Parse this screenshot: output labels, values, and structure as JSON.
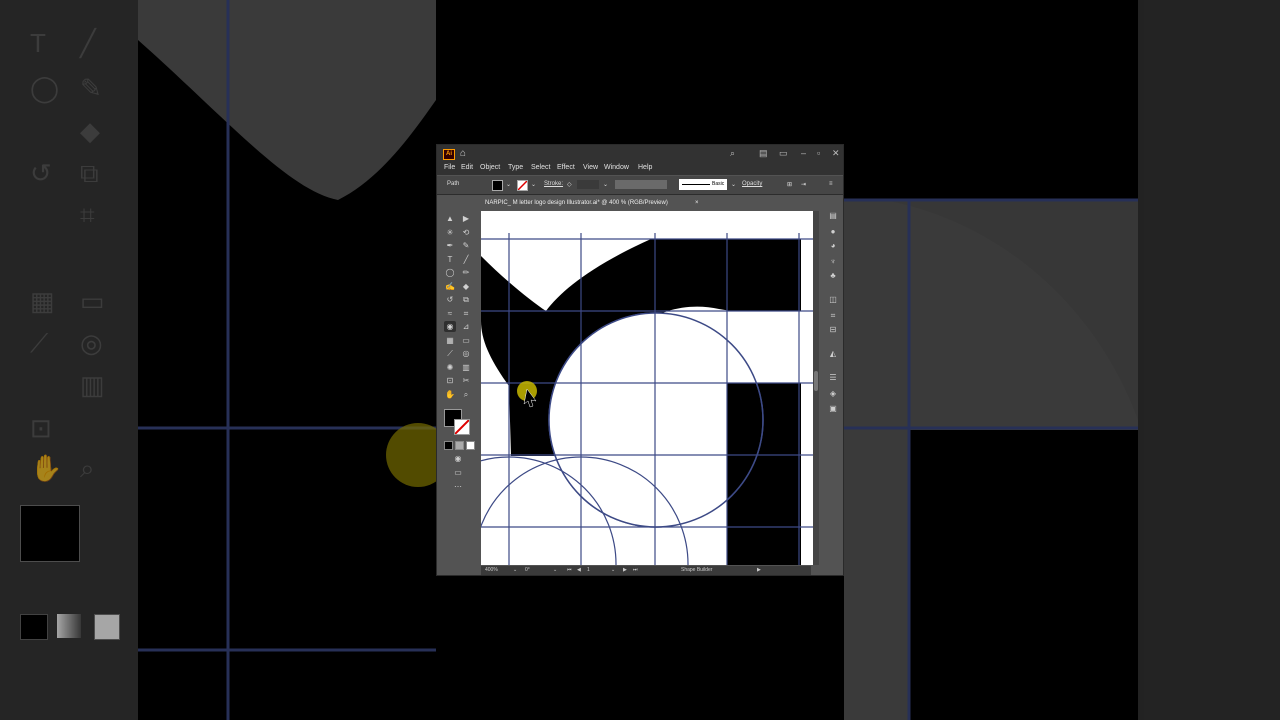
{
  "window": {
    "app_icon_label": "Ai",
    "home_icon": "home-icon",
    "search_icon": "search-icon",
    "minimize_icon": "minimize-icon",
    "restore_icon": "restore-icon",
    "close_icon": "close-icon"
  },
  "menu": [
    "File",
    "Edit",
    "Object",
    "Type",
    "Select",
    "Effect",
    "View",
    "Window",
    "Help"
  ],
  "control_bar": {
    "selection_label": "Path",
    "stroke_label": "Stroke:",
    "brush_label": "Basic",
    "opacity_label": "Opacity"
  },
  "document_tab": {
    "title": "NARPIC_ M letter logo design Illustrator.ai* @ 400 % (RGB/Preview)",
    "close_glyph": "×"
  },
  "status_bar": {
    "zoom": "400%",
    "rotation": "0°",
    "artboard": "1",
    "current_tool": "Shape Builder"
  },
  "tools": [
    "selection-tool",
    "direct-selection-tool",
    "magic-wand-tool",
    "lasso-tool",
    "pen-tool",
    "curvature-tool",
    "type-tool",
    "line-tool",
    "ellipse-tool",
    "paintbrush-tool",
    "shaper-tool",
    "eraser-tool",
    "rotate-tool",
    "scale-tool",
    "warp-tool",
    "free-transform-tool",
    "shape-builder-tool",
    "perspective-tool",
    "mesh-tool",
    "gradient-tool",
    "eyedropper-tool",
    "blend-tool",
    "symbol-sprayer-tool",
    "column-graph-tool",
    "artboard-tool",
    "slice-tool",
    "hand-tool",
    "zoom-tool"
  ],
  "colors": {
    "fill": "#000000",
    "stroke": "none",
    "guide_line": "#3d4a86",
    "cursor_highlight": "#c8b800",
    "chrome_dark": "#323232",
    "chrome_mid": "#535353"
  }
}
